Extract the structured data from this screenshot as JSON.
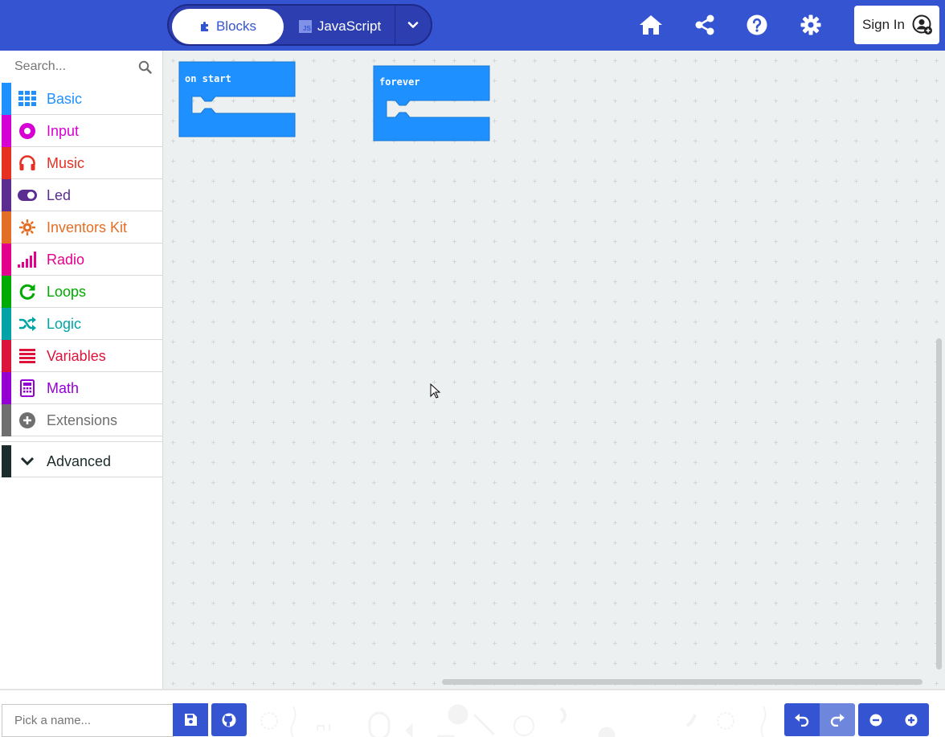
{
  "header": {
    "mode_toggle": {
      "blocks_label": "Blocks",
      "javascript_label": "JavaScript",
      "js_badge": "JS"
    },
    "actions": [
      "home-icon",
      "share-icon",
      "help-icon",
      "settings-icon"
    ],
    "sign_in_label": "Sign In",
    "colors": {
      "bar": "#3454d1",
      "toggle": "#2c3eb0"
    }
  },
  "sidebar": {
    "search_placeholder": "Search...",
    "categories": [
      {
        "label": "Basic",
        "color": "#1e90ff",
        "icon": "grid-icon"
      },
      {
        "label": "Input",
        "color": "#d400d4",
        "icon": "circle-dot-icon"
      },
      {
        "label": "Music",
        "color": "#e63022",
        "icon": "headphones-icon"
      },
      {
        "label": "Led",
        "color": "#5c2d91",
        "icon": "toggle-icon"
      },
      {
        "label": "Inventors Kit",
        "color": "#e36e25",
        "icon": "gear-sun-icon"
      },
      {
        "label": "Radio",
        "color": "#e3008c",
        "icon": "signal-bars-icon"
      },
      {
        "label": "Loops",
        "color": "#00aa00",
        "icon": "refresh-icon"
      },
      {
        "label": "Logic",
        "color": "#00a4a6",
        "icon": "shuffle-icon"
      },
      {
        "label": "Variables",
        "color": "#dc143c",
        "icon": "lines-icon"
      },
      {
        "label": "Math",
        "color": "#9400d3",
        "icon": "calculator-icon"
      },
      {
        "label": "Extensions",
        "color": "#6f6f6f",
        "icon": "plus-circle-icon"
      }
    ],
    "advanced": {
      "label": "Advanced",
      "color": "#1c2b2b",
      "icon": "chevron-down-icon"
    }
  },
  "workspace": {
    "blocks": [
      {
        "label": "on start",
        "color": "#1e90ff"
      },
      {
        "label": "forever",
        "color": "#1e90ff"
      }
    ]
  },
  "footer": {
    "project_name_placeholder": "Pick a name...",
    "buttons": [
      "save-icon",
      "github-icon",
      "undo-icon",
      "redo-icon",
      "zoom-out-icon",
      "zoom-in-icon"
    ]
  }
}
